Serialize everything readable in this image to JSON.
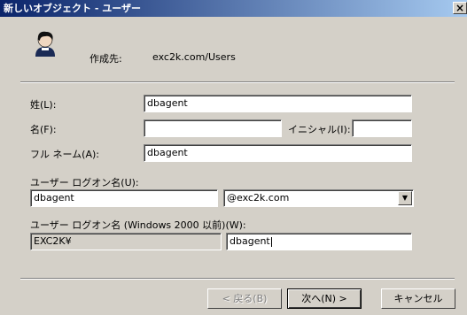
{
  "window": {
    "title": "新しいオブジェクト - ユーザー",
    "close_glyph": "×"
  },
  "header": {
    "created_in_label": "作成先:",
    "created_in_value": "exc2k.com/Users",
    "icon": "user-icon"
  },
  "form": {
    "last_name_label": "姓(L):",
    "last_name_value": "dbagent",
    "first_name_label": "名(F):",
    "first_name_value": "",
    "initials_label": "イニシャル(I):",
    "initials_value": "",
    "full_name_label": "フル ネーム(A):",
    "full_name_value": "dbagent",
    "logon_name_label": "ユーザー ログオン名(U):",
    "logon_name_value": "dbagent",
    "domain_selected": "@exc2k.com",
    "pre2000_label": "ユーザー ログオン名 (Windows 2000 以前)(W):",
    "pre2000_domain": "EXC2K¥",
    "pre2000_value": "dbagent"
  },
  "buttons": {
    "back": "< 戻る(B)",
    "next": "次へ(N) >",
    "cancel": "キャンセル"
  }
}
